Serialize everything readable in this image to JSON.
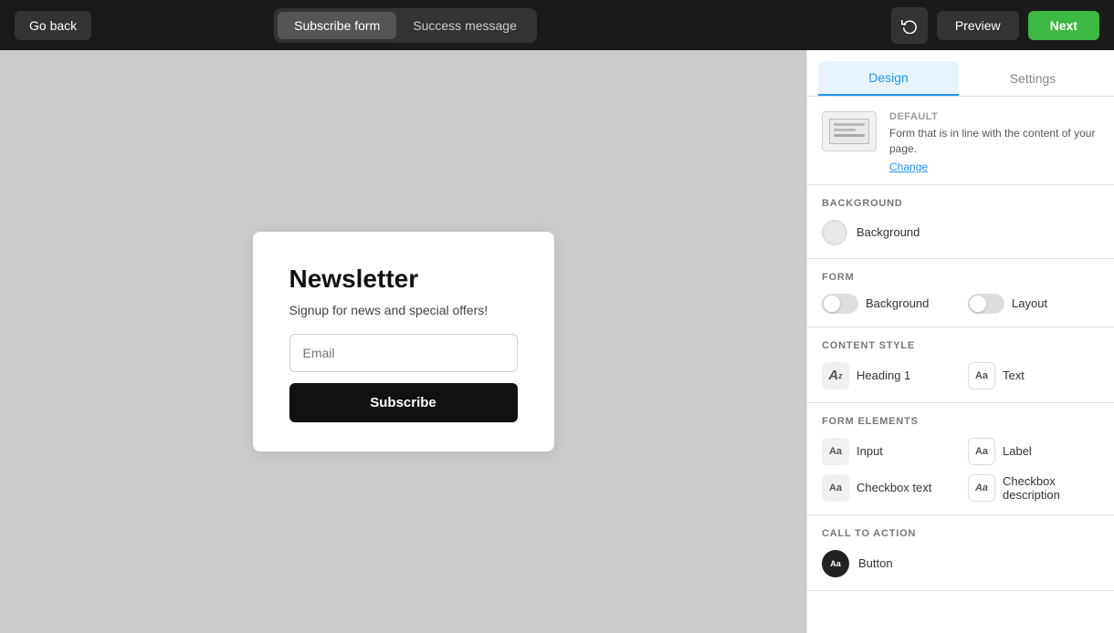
{
  "topbar": {
    "go_back_label": "Go back",
    "tabs": [
      {
        "id": "subscribe-form",
        "label": "Subscribe form",
        "active": true
      },
      {
        "id": "success-message",
        "label": "Success message",
        "active": false
      }
    ],
    "preview_label": "Preview",
    "next_label": "Next"
  },
  "form_preview": {
    "title": "Newsletter",
    "subtitle": "Signup for news and special offers!",
    "email_placeholder": "Email",
    "subscribe_label": "Subscribe"
  },
  "right_panel": {
    "tabs": [
      {
        "id": "design",
        "label": "Design",
        "active": true
      },
      {
        "id": "settings",
        "label": "Settings",
        "active": false
      }
    ],
    "default_section": {
      "label": "DEFAULT",
      "description": "Form that is in line with the content of your page.",
      "change_label": "Change"
    },
    "background_section": {
      "title": "BACKGROUND",
      "color_label": "Background"
    },
    "form_section": {
      "title": "FORM",
      "background_label": "Background",
      "layout_label": "Layout"
    },
    "content_style_section": {
      "title": "CONTENT STYLE",
      "heading_label": "Heading 1",
      "text_label": "Text"
    },
    "form_elements_section": {
      "title": "FORM ELEMENTS",
      "input_label": "Input",
      "label_label": "Label",
      "checkbox_text_label": "Checkbox text",
      "checkbox_desc_label": "Checkbox description"
    },
    "call_to_action_section": {
      "title": "CALL TO ACTION",
      "button_label": "Button"
    }
  }
}
